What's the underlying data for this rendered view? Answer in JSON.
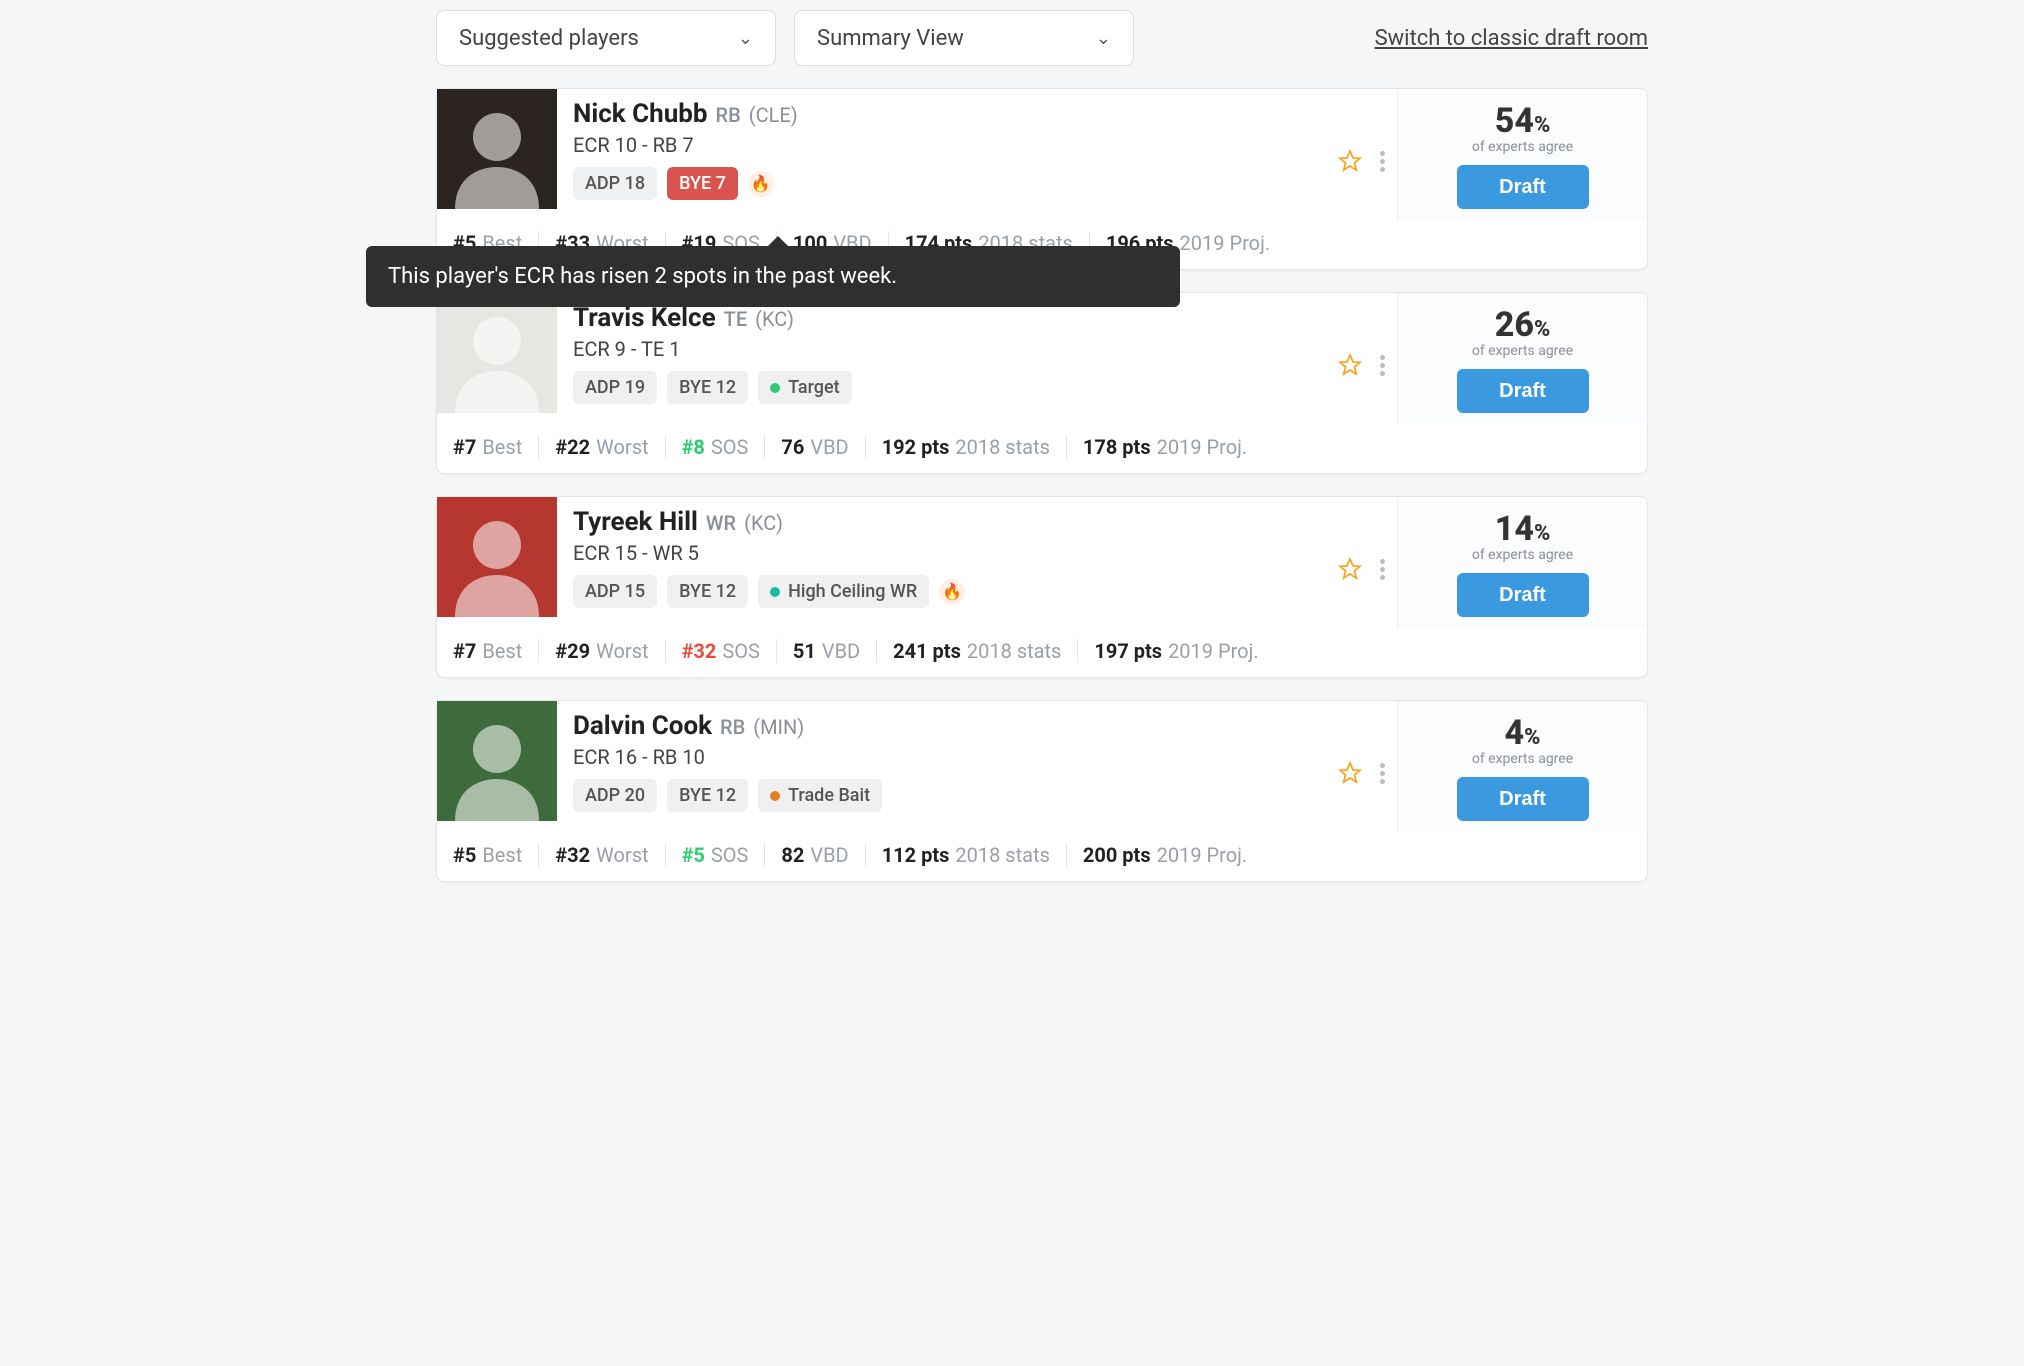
{
  "topbar": {
    "select_players": "Suggested players",
    "select_view": "Summary View",
    "switch_link": "Switch to classic draft room"
  },
  "tooltip": "This player's ECR has risen 2 spots in the past week.",
  "labels": {
    "of_experts": "of experts agree",
    "draft": "Draft",
    "best": "Best",
    "worst": "Worst",
    "sos": "SOS",
    "vbd": "VBD",
    "stats2018": "2018 stats",
    "proj2019": "2019 Proj."
  },
  "players": [
    {
      "name": "Nick Chubb",
      "pos": "RB",
      "team": "(CLE)",
      "ecr": "ECR 10 - RB 7",
      "adp": "ADP 18",
      "bye": "BYE 7",
      "bye_red": true,
      "extra_tag": null,
      "fire": true,
      "pct": "54",
      "best": "#5",
      "worst": "#33",
      "sos": "#19",
      "sos_color": "",
      "vbd": "100",
      "pts2018": "174 pts",
      "pts2019": "196 pts",
      "photo_bg": "#2c2420"
    },
    {
      "name": "Travis Kelce",
      "pos": "TE",
      "team": "(KC)",
      "ecr": "ECR 9 - TE 1",
      "adp": "ADP 19",
      "bye": "BYE 12",
      "bye_red": false,
      "extra_tag": {
        "dot": "green",
        "text": "Target"
      },
      "fire": false,
      "pct": "26",
      "best": "#7",
      "worst": "#22",
      "sos": "#8",
      "sos_color": "green",
      "vbd": "76",
      "pts2018": "192 pts",
      "pts2019": "178 pts",
      "photo_bg": "#e8e6e2"
    },
    {
      "name": "Tyreek Hill",
      "pos": "WR",
      "team": "(KC)",
      "ecr": "ECR 15 - WR 5",
      "adp": "ADP 15",
      "bye": "BYE 12",
      "bye_red": false,
      "extra_tag": {
        "dot": "teal",
        "text": "High Ceiling WR"
      },
      "fire": true,
      "pct": "14",
      "best": "#7",
      "worst": "#29",
      "sos": "#32",
      "sos_color": "red",
      "vbd": "51",
      "pts2018": "241 pts",
      "pts2019": "197 pts",
      "photo_bg": "#b5372f"
    },
    {
      "name": "Dalvin Cook",
      "pos": "RB",
      "team": "(MIN)",
      "ecr": "ECR 16 - RB 10",
      "adp": "ADP 20",
      "bye": "BYE 12",
      "bye_red": false,
      "extra_tag": {
        "dot": "orange",
        "text": "Trade Bait"
      },
      "fire": false,
      "pct": "4",
      "best": "#5",
      "worst": "#32",
      "sos": "#5",
      "sos_color": "green",
      "vbd": "82",
      "pts2018": "112 pts",
      "pts2019": "200 pts",
      "photo_bg": "#3e6b3b"
    }
  ]
}
